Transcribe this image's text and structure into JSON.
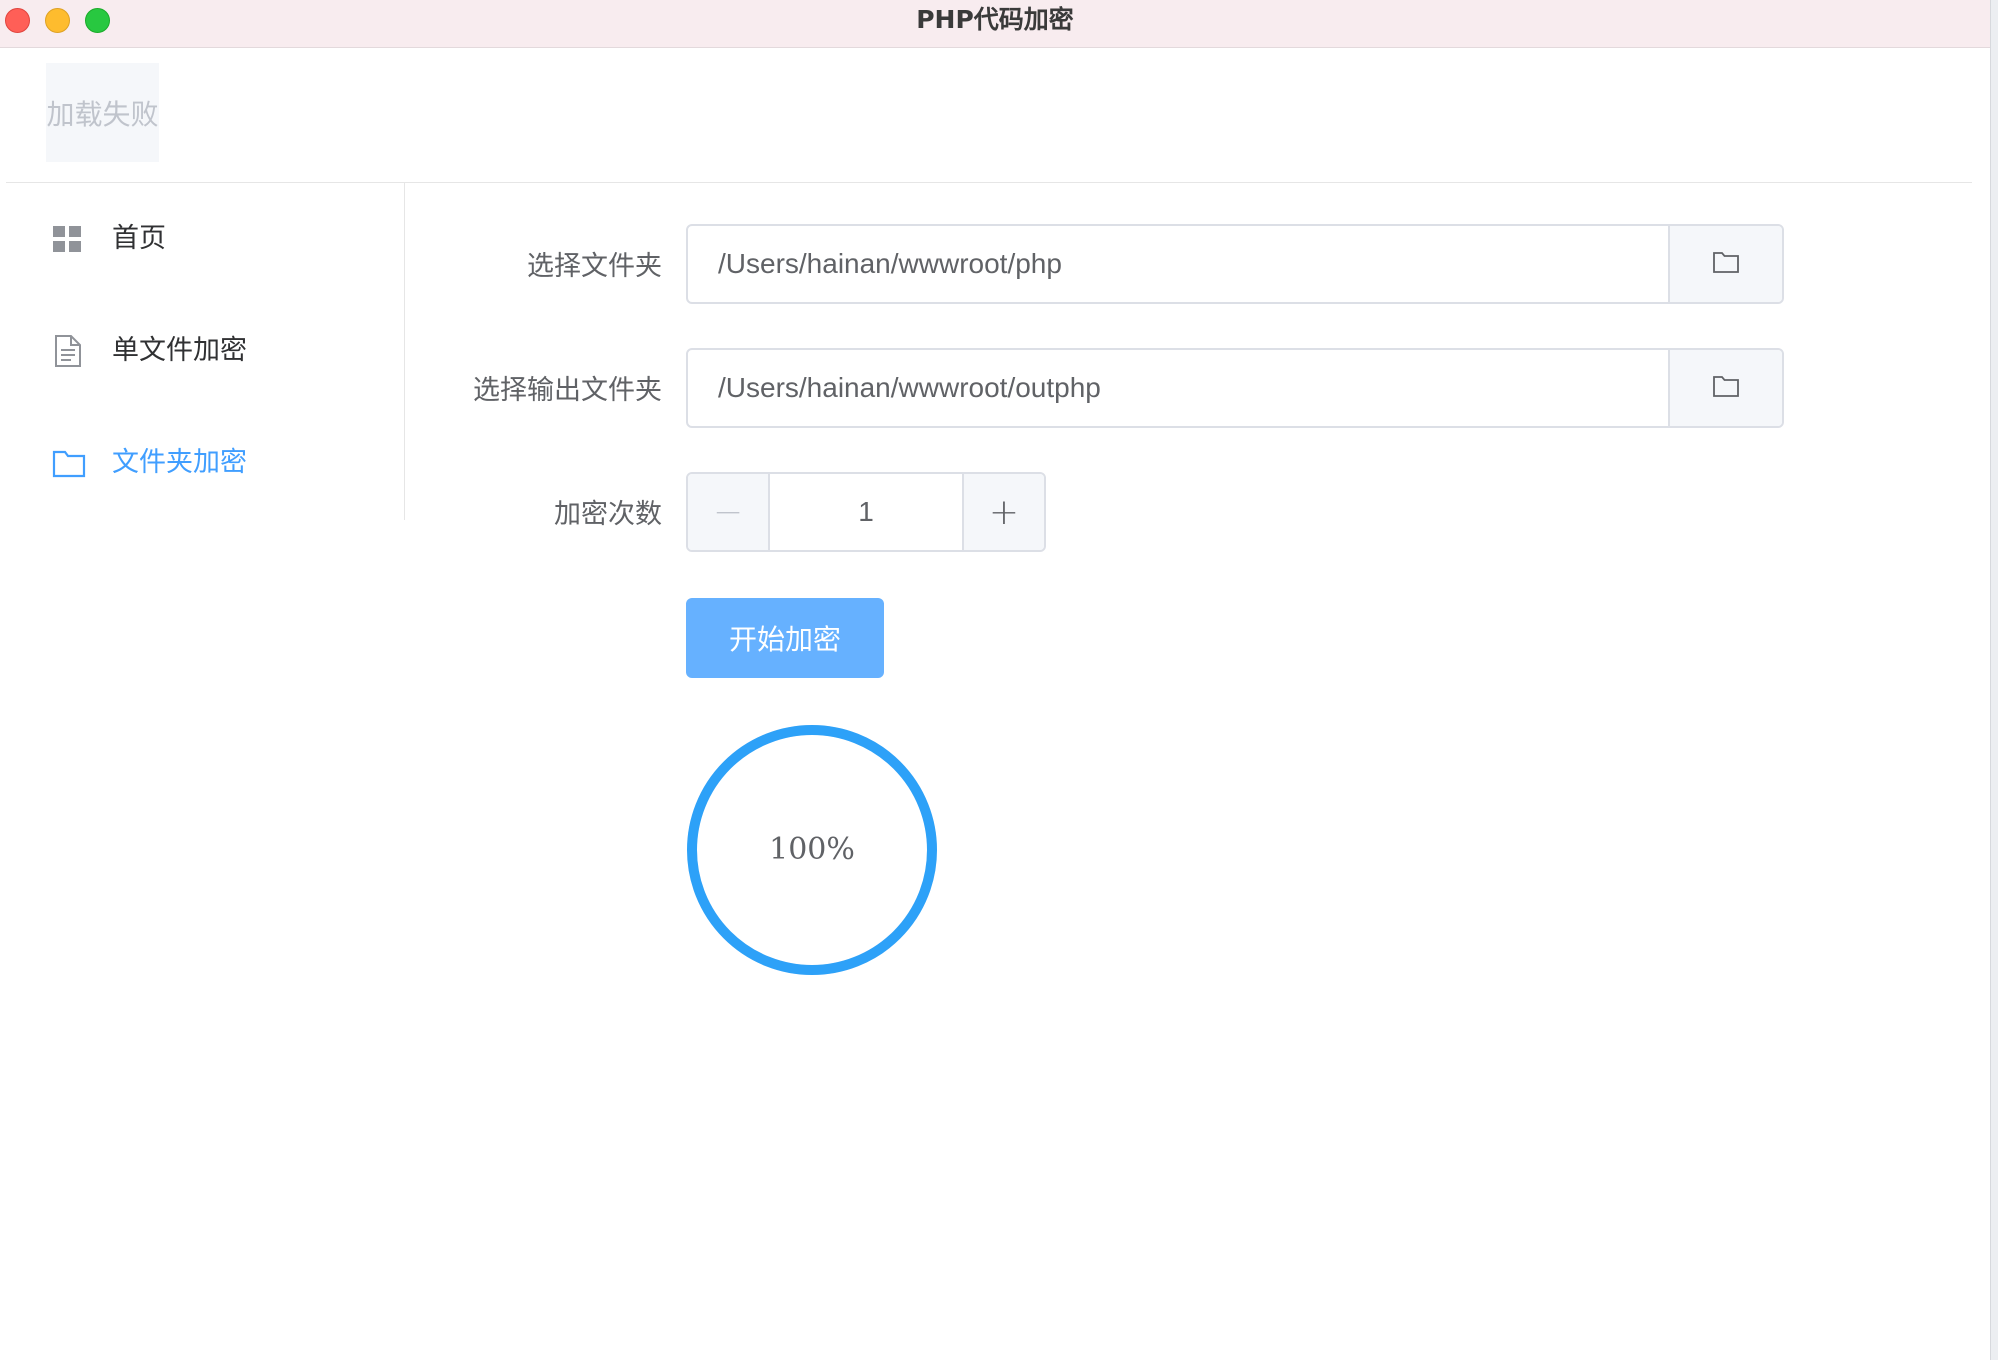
{
  "window": {
    "title": "PHP代码加密"
  },
  "header": {
    "logo_alt": "加载失败"
  },
  "sidebar": {
    "items": [
      {
        "label": "首页",
        "icon": "grid-icon",
        "active": false
      },
      {
        "label": "单文件加密",
        "icon": "document-icon",
        "active": false
      },
      {
        "label": "文件夹加密",
        "icon": "folder-icon",
        "active": true
      }
    ]
  },
  "form": {
    "source_folder": {
      "label": "选择文件夹",
      "value": "/Users/hainan/wwwroot/php",
      "button_icon": "folder-icon"
    },
    "output_folder": {
      "label": "选择输出文件夹",
      "value": "/Users/hainan/wwwroot/outphp",
      "button_icon": "folder-icon"
    },
    "encrypt_count": {
      "label": "加密次数",
      "value": "1",
      "minus": "−",
      "plus": "+"
    },
    "start_button": "开始加密"
  },
  "progress": {
    "percentage": 100,
    "text": "100%"
  },
  "colors": {
    "accent": "#409eff",
    "primary_button": "#66b1ff",
    "progress_ring": "#2da1f8",
    "titlebar": "#f8ecef"
  }
}
